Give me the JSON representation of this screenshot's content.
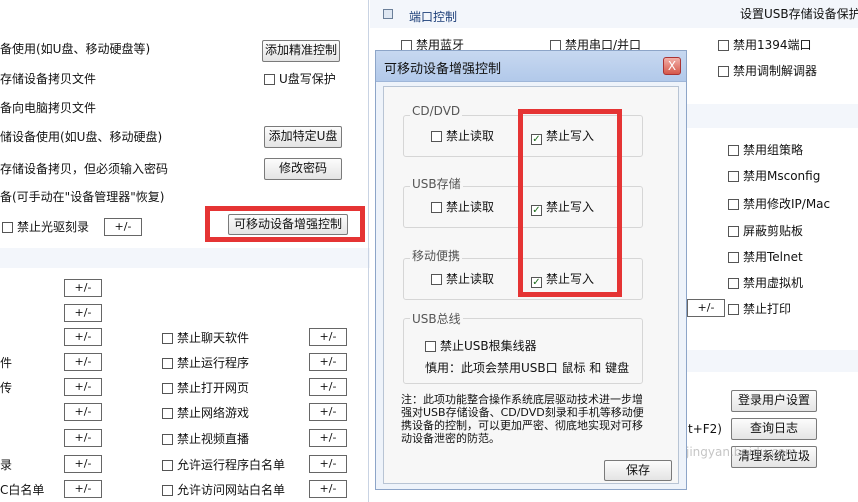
{
  "left_panel": {
    "rows": [
      {
        "text": "备使用(如U盘、移动硬盘等)"
      },
      {
        "text": "存储设备拷贝文件"
      },
      {
        "text": "备向电脑拷贝文件"
      },
      {
        "text": "储设备使用(如U盘、移动硬盘)"
      },
      {
        "text": "存储设备拷贝，但必须输入密码"
      },
      {
        "text": "备(可手动在\"设备管理器\"恢复)"
      }
    ],
    "add_precise_button": "添加精准控制",
    "usb_write_protect": "U盘写保护",
    "add_specific_usb_button": "添加特定U盘",
    "change_password_button": "修改密码",
    "disable_cd_burn": "禁止光驱刻录",
    "plus_minus": "+/-",
    "enhanced_control_button": "可移动设备增强控制",
    "lower_left_rows": [
      "",
      "",
      "",
      "件",
      "传",
      "",
      "",
      "录",
      "C白名单"
    ],
    "lower_mid_rows": [
      "禁止聊天软件",
      "禁止运行程序",
      "禁止打开网页",
      "禁止网络游戏",
      "禁止视频直播",
      "允许运行程序白名单",
      "允许访问网站白名单"
    ]
  },
  "right_panel": {
    "port_control_title": "端口控制",
    "usb_storage_protect": "设置USB存储设备保护",
    "disable_bluetooth": "禁用蓝牙",
    "disable_serial": "禁用串口/并口",
    "disable_1394": "禁用1394端口",
    "disable_modem": "禁用调制解调器",
    "items": [
      "禁用组策略",
      "禁用Msconfig",
      "禁用修改IP/Mac",
      "屏蔽剪贴板",
      "禁用Telnet",
      "禁用虚拟机",
      "禁止打印"
    ],
    "hotkey_fragment": "t+F2)",
    "login_settings_button": "登录用户设置",
    "query_log_button": "查询日志",
    "clean_trash_button": "清理系统垃圾"
  },
  "dialog": {
    "title": "可移动设备增强控制",
    "close": "X",
    "groups": [
      {
        "label": "CD/DVD",
        "read": "禁止读取",
        "write": "禁止写入",
        "read_checked": false,
        "write_checked": true
      },
      {
        "label": "USB存储",
        "read": "禁止读取",
        "write": "禁止写入",
        "read_checked": false,
        "write_checked": true
      },
      {
        "label": "移动便携",
        "read": "禁止读取",
        "write": "禁止写入",
        "read_checked": false,
        "write_checked": true
      }
    ],
    "usb_bus": {
      "label": "USB总线",
      "option": "禁止USB根集线器",
      "warning": "慎用：此项会禁用USB口 鼠标 和 键盘"
    },
    "note": "注：此项功能整合操作系统底层驱动技术进一步增强对USB存储设备、CD/DVD刻录和手机等移动便携设备的控制，可以更加严密、彻底地实现对可移动设备泄密的防范。",
    "save_button": "保存"
  },
  "watermark": "jingyan.baidu.com",
  "colors": {
    "highlight_red": "#e53434",
    "check_green": "#1a6b1a"
  }
}
